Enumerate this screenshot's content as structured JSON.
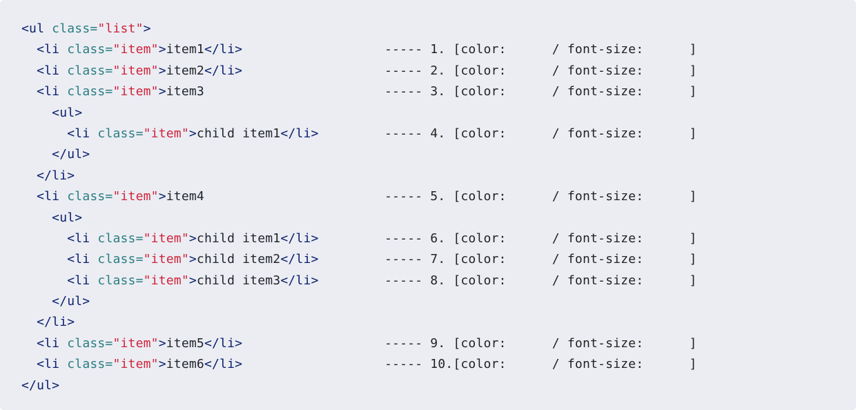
{
  "code_lines": [
    {
      "indent": "",
      "open": "<ul",
      "attr": "class=",
      "val": "\"list\"",
      "close": ">",
      "text": "",
      "end": "",
      "note": ""
    },
    {
      "indent": "  ",
      "open": "<li",
      "attr": "class=",
      "val": "\"item\"",
      "close": ">",
      "text": "item1",
      "end": "</li>",
      "note": "----- 1. [color:      / font-size:      ]"
    },
    {
      "indent": "  ",
      "open": "<li",
      "attr": "class=",
      "val": "\"item\"",
      "close": ">",
      "text": "item2",
      "end": "</li>",
      "note": "----- 2. [color:      / font-size:      ]"
    },
    {
      "indent": "  ",
      "open": "<li",
      "attr": "class=",
      "val": "\"item\"",
      "close": ">",
      "text": "item3",
      "end": "",
      "note": "----- 3. [color:      / font-size:      ]"
    },
    {
      "indent": "    ",
      "open": "<ul>",
      "attr": "",
      "val": "",
      "close": "",
      "text": "",
      "end": "",
      "note": ""
    },
    {
      "indent": "      ",
      "open": "<li",
      "attr": "class=",
      "val": "\"item\"",
      "close": ">",
      "text": "child item1",
      "end": "</li>",
      "note": "----- 4. [color:      / font-size:      ]"
    },
    {
      "indent": "    ",
      "open": "</ul>",
      "attr": "",
      "val": "",
      "close": "",
      "text": "",
      "end": "",
      "note": ""
    },
    {
      "indent": "  ",
      "open": "</li>",
      "attr": "",
      "val": "",
      "close": "",
      "text": "",
      "end": "",
      "note": ""
    },
    {
      "indent": "  ",
      "open": "<li",
      "attr": "class=",
      "val": "\"item\"",
      "close": ">",
      "text": "item4",
      "end": "",
      "note": "----- 5. [color:      / font-size:      ]"
    },
    {
      "indent": "    ",
      "open": "<ul>",
      "attr": "",
      "val": "",
      "close": "",
      "text": "",
      "end": "",
      "note": ""
    },
    {
      "indent": "      ",
      "open": "<li",
      "attr": "class=",
      "val": "\"item\"",
      "close": ">",
      "text": "child item1",
      "end": "</li>",
      "note": "----- 6. [color:      / font-size:      ]"
    },
    {
      "indent": "      ",
      "open": "<li",
      "attr": "class=",
      "val": "\"item\"",
      "close": ">",
      "text": "child item2",
      "end": "</li>",
      "note": "----- 7. [color:      / font-size:      ]"
    },
    {
      "indent": "      ",
      "open": "<li",
      "attr": "class=",
      "val": "\"item\"",
      "close": ">",
      "text": "child item3",
      "end": "</li>",
      "note": "----- 8. [color:      / font-size:      ]"
    },
    {
      "indent": "    ",
      "open": "</ul>",
      "attr": "",
      "val": "",
      "close": "",
      "text": "",
      "end": "",
      "note": ""
    },
    {
      "indent": "  ",
      "open": "</li>",
      "attr": "",
      "val": "",
      "close": "",
      "text": "",
      "end": "",
      "note": ""
    },
    {
      "indent": "  ",
      "open": "<li",
      "attr": "class=",
      "val": "\"item\"",
      "close": ">",
      "text": "item5",
      "end": "</li>",
      "note": "----- 9. [color:      / font-size:      ]"
    },
    {
      "indent": "  ",
      "open": "<li",
      "attr": "class=",
      "val": "\"item\"",
      "close": ">",
      "text": "item6",
      "end": "</li>",
      "note": "----- 10.[color:      / font-size:      ]"
    },
    {
      "indent": "",
      "open": "</ul>",
      "attr": "",
      "val": "",
      "close": "",
      "text": "",
      "end": "",
      "note": ""
    }
  ]
}
